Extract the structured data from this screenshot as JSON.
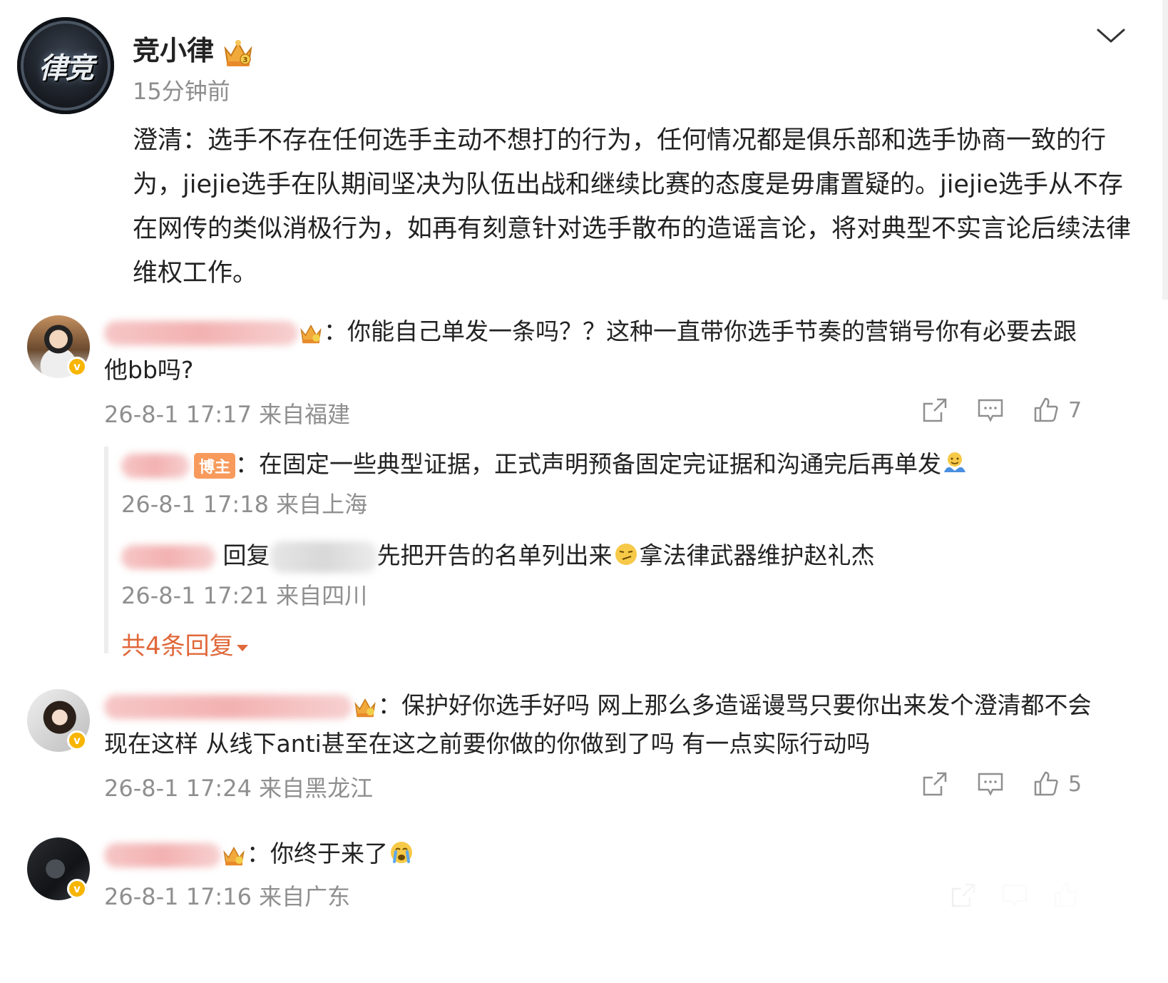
{
  "post": {
    "author": "竞小律",
    "avatar_logo_text": "律竞",
    "time": "15分钟前",
    "body": "澄清：选手不存在任何选手主动不想打的行为，任何情况都是俱乐部和选手协商一致的行为，jiejie选手在队期间坚决为队伍出战和继续比赛的态度是毋庸置疑的。jiejie选手从不存在网传的类似消极行为，如再有刻意针对选手散布的造谣言论，将对典型不实言论后续法律维权工作。",
    "icons": {
      "collapse": "chevron-down-icon",
      "crown": "crown-badge-icon"
    }
  },
  "comments": [
    {
      "text_line1": "：你能自己单发一条吗？？这种一直带你选手节奏的营销号你有必要去跟",
      "text_line2": "他bb吗?",
      "meta": "26-8-1 17:17 来自福建",
      "like_count": "7",
      "verified_icon": "v",
      "replies": [
        {
          "host_label": "博主",
          "text": "：在固定一些典型证据，正式声明预备固定完证据和沟通完后再单发",
          "emoji": "hug-emoji",
          "meta": "26-8-1 17:18 来自上海"
        },
        {
          "reply_word": "回复",
          "text_part1": "先把开告的名单列出来",
          "emoji": "smirk-emoji",
          "text_part2": "拿法律武器维护赵礼杰",
          "meta": "26-8-1 17:21 来自四川"
        }
      ],
      "more_replies": "共4条回复"
    },
    {
      "text_line1": "：保护好你选手好吗 网上那么多造谣谩骂只要你出来发个澄清都不会",
      "text_line2": "现在这样 从线下anti甚至在这之前要你做的你做到了吗 有一点实际行动吗",
      "meta": "26-8-1 17:24 来自黑龙江",
      "like_count": "5",
      "verified_icon": "v"
    },
    {
      "text_line1": "：你终于来了",
      "emoji": "crying-emoji",
      "meta": "26-8-1 17:16 来自广东",
      "verified_icon": "v"
    }
  ],
  "action_icons": [
    "share-icon",
    "comment-icon",
    "like-icon"
  ],
  "colors": {
    "accent": "#e0683a",
    "meta_grey": "#8f8f8f",
    "verify": "#f7b500",
    "host_tag": "#f79a5c"
  }
}
